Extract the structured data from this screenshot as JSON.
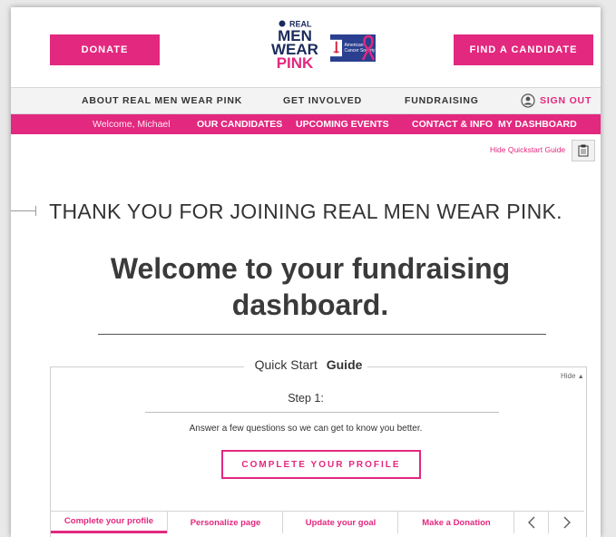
{
  "header": {
    "donate_label": "DONATE",
    "find_candidate_label": "FIND A CANDIDATE",
    "logo": {
      "line1": "REAL",
      "line2": "MEN",
      "line3": "WEAR",
      "line4": "PINK",
      "acs_text": "American Cancer Society"
    }
  },
  "nav_primary": {
    "items": [
      {
        "label": "ABOUT REAL MEN WEAR PINK"
      },
      {
        "label": "GET INVOLVED"
      },
      {
        "label": "FUNDRAISING"
      }
    ],
    "sign_out_label": "SIGN OUT"
  },
  "nav_secondary": {
    "welcome": "Welcome, Michael",
    "items": [
      {
        "label": "OUR CANDIDATES"
      },
      {
        "label": "UPCOMING EVENTS"
      },
      {
        "label": "CONTACT & INFO"
      },
      {
        "label": "MY DASHBOARD"
      }
    ]
  },
  "quickstart_toggle": {
    "label": "Hide Quickstart Guide"
  },
  "main": {
    "thank_you": "THANK YOU FOR JOINING REAL MEN WEAR PINK.",
    "welcome_heading": "Welcome to your fundraising dashboard."
  },
  "quick_start": {
    "title_part1": "Quick Start",
    "title_part2": "Guide",
    "hide_label": "Hide",
    "step_label": "Step 1:",
    "step_description": "Answer a few questions so we can get to know you better.",
    "cta_label": "COMPLETE YOUR PROFILE",
    "tabs": [
      {
        "label": "Complete your profile"
      },
      {
        "label": "Personalize page"
      },
      {
        "label": "Update your goal"
      },
      {
        "label": "Make a Donation"
      }
    ],
    "prev_icon": "chevron-left-icon",
    "next_icon": "chevron-right-icon"
  },
  "colors": {
    "brand_pink": "#e3287f",
    "navy": "#1a2b5b"
  }
}
